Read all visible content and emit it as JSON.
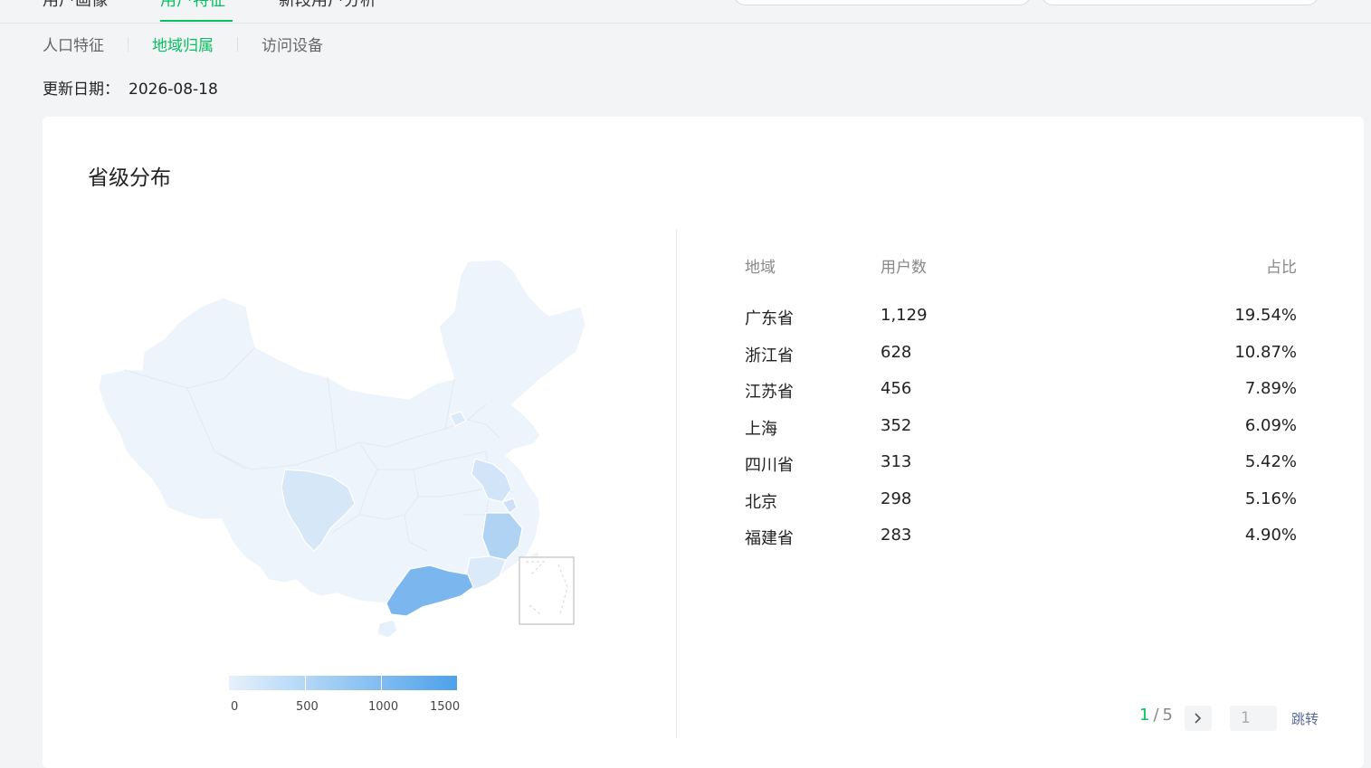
{
  "top_tabs": [
    {
      "label": "用户画像"
    },
    {
      "label": "用户特征"
    },
    {
      "label": "新段用户分析"
    }
  ],
  "sub_tabs": [
    {
      "label": "人口特征",
      "active": false
    },
    {
      "label": "地域归属",
      "active": true
    },
    {
      "label": "访问设备",
      "active": false
    }
  ],
  "update": {
    "label": "更新日期：",
    "value": "2026-08-18"
  },
  "card": {
    "title": "省级分布"
  },
  "legend": {
    "labels": [
      "0",
      "500",
      "1000",
      "1500"
    ],
    "min": 0,
    "max": 1500,
    "color_low": "#e6f1fc",
    "color_high": "#4ea1ea"
  },
  "table": {
    "headers": {
      "region": "地域",
      "users": "用户数",
      "share": "占比"
    },
    "rows": [
      {
        "region": "广东省",
        "users": "1,129",
        "share": "19.54%"
      },
      {
        "region": "浙江省",
        "users": "628",
        "share": "10.87%"
      },
      {
        "region": "江苏省",
        "users": "456",
        "share": "7.89%"
      },
      {
        "region": "上海",
        "users": "352",
        "share": "6.09%"
      },
      {
        "region": "四川省",
        "users": "313",
        "share": "5.42%"
      },
      {
        "region": "北京",
        "users": "298",
        "share": "5.16%"
      },
      {
        "region": "福建省",
        "users": "283",
        "share": "4.90%"
      }
    ]
  },
  "pager": {
    "current": "1",
    "sep": "/",
    "total": "5",
    "input_value": "1",
    "jump_label": "跳转"
  },
  "colors": {
    "accent": "#07c160",
    "link": "#576b95"
  }
}
